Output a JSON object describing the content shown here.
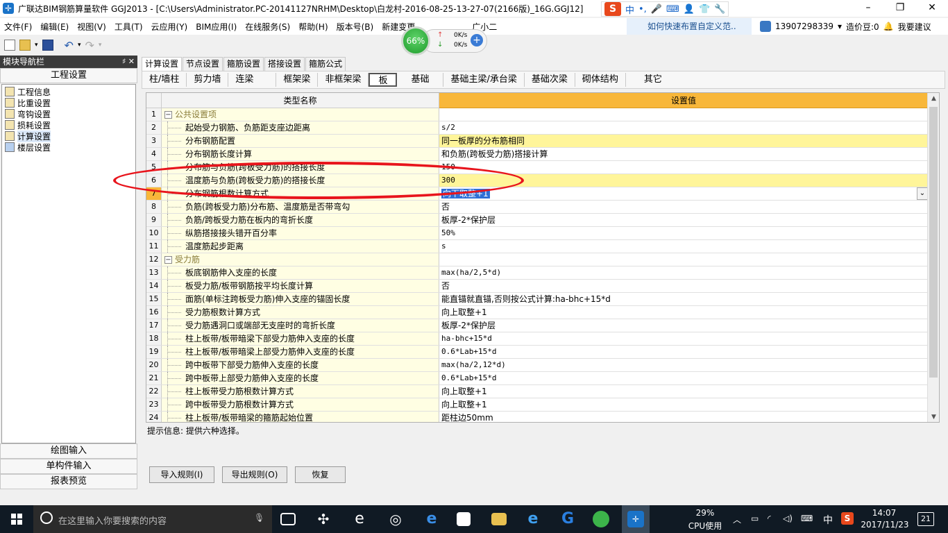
{
  "window": {
    "title": "广联达BIM钢筋算量软件 GGJ2013 - [C:\\Users\\Administrator.PC-20141127NRHM\\Desktop\\白龙村-2016-08-25-13-27-07(2166版)_16G.GGJ12]",
    "ime_label": "中",
    "controls": [
      "–",
      "❐",
      "✕"
    ]
  },
  "menu": {
    "items": [
      "文件(F)",
      "编辑(E)",
      "视图(V)",
      "工具(T)",
      "云应用(Y)",
      "BIM应用(I)",
      "在线服务(S)",
      "帮助(H)",
      "版本号(B)",
      "新建变更",
      "广小二"
    ],
    "help_link": "如何快速布置自定义范..",
    "phone": "13907298339",
    "coins": "造价豆:0",
    "feedback": "我要建议"
  },
  "speed": {
    "percent": "66%",
    "up": "0K/s",
    "down": "0K/s"
  },
  "nav": {
    "header": "模块导航栏",
    "header_ctrls": "♯ ✕",
    "section_top": "工程设置",
    "items": [
      "工程信息",
      "比重设置",
      "弯钩设置",
      "损耗设置",
      "计算设置",
      "楼层设置"
    ],
    "selected_index": 4,
    "bottom_sections": [
      "绘图输入",
      "单构件输入",
      "报表预览"
    ]
  },
  "tabs_top": [
    "计算设置",
    "节点设置",
    "箍筋设置",
    "搭接设置",
    "箍筋公式"
  ],
  "tabs_sub": [
    "柱/墙柱",
    "剪力墙",
    "连梁",
    "框架梁",
    "非框架梁",
    "板",
    "基础",
    "基础主梁/承台梁",
    "基础次梁",
    "砌体结构",
    "其它"
  ],
  "grid": {
    "col_name": "类型名称",
    "col_value": "设置值",
    "rows": [
      {
        "n": "1",
        "name": "公共设置项",
        "value": "",
        "group": true
      },
      {
        "n": "2",
        "name": "起始受力钢筋、负筋距支座边距离",
        "value": "s/2"
      },
      {
        "n": "3",
        "name": "分布钢筋配置",
        "value": "同一板厚的分布筋相同",
        "hl": true,
        "cjk": true
      },
      {
        "n": "4",
        "name": "分布钢筋长度计算",
        "value": "和负筋(跨板受力筋)搭接计算",
        "cjk": true
      },
      {
        "n": "5",
        "name": "分布筋与负筋(跨板受力筋)的搭接长度",
        "value": "150"
      },
      {
        "n": "6",
        "name": "温度筋与负筋(跨板受力筋)的搭接长度",
        "value": "300",
        "hl": true
      },
      {
        "n": "7",
        "name": "分布钢筋根数计算方式",
        "value": "向下取整+1",
        "editing": true,
        "cjk": true
      },
      {
        "n": "8",
        "name": "负筋(跨板受力筋)分布筋、温度筋是否带弯勾",
        "value": "否",
        "cjk": true
      },
      {
        "n": "9",
        "name": "负筋/跨板受力筋在板内的弯折长度",
        "value": "板厚-2*保护层",
        "cjk": true
      },
      {
        "n": "10",
        "name": "纵筋搭接接头错开百分率",
        "value": "50%"
      },
      {
        "n": "11",
        "name": "温度筋起步距离",
        "value": "s"
      },
      {
        "n": "12",
        "name": "受力筋",
        "value": "",
        "group": true
      },
      {
        "n": "13",
        "name": "板底钢筋伸入支座的长度",
        "value": "max(ha/2,5*d)"
      },
      {
        "n": "14",
        "name": "板受力筋/板带钢筋按平均长度计算",
        "value": "否",
        "cjk": true
      },
      {
        "n": "15",
        "name": "面筋(单标注跨板受力筋)伸入支座的锚固长度",
        "value": "能直锚就直锚,否则按公式计算:ha-bhc+15*d",
        "cjk": true
      },
      {
        "n": "16",
        "name": "受力筋根数计算方式",
        "value": "向上取整+1",
        "cjk": true
      },
      {
        "n": "17",
        "name": "受力筋遇洞口或端部无支座时的弯折长度",
        "value": "板厚-2*保护层",
        "cjk": true
      },
      {
        "n": "18",
        "name": "柱上板带/板带暗梁下部受力筋伸入支座的长度",
        "value": "ha-bhc+15*d"
      },
      {
        "n": "19",
        "name": "柱上板带/板带暗梁上部受力筋伸入支座的长度",
        "value": "0.6*Lab+15*d"
      },
      {
        "n": "20",
        "name": "跨中板带下部受力筋伸入支座的长度",
        "value": "max(ha/2,12*d)"
      },
      {
        "n": "21",
        "name": "跨中板带上部受力筋伸入支座的长度",
        "value": "0.6*Lab+15*d"
      },
      {
        "n": "22",
        "name": "柱上板带受力筋根数计算方式",
        "value": "向上取整+1",
        "cjk": true
      },
      {
        "n": "23",
        "name": "跨中板带受力筋根数计算方式",
        "value": "向上取整+1",
        "cjk": true
      },
      {
        "n": "24",
        "name": "柱上板带/板带暗梁的箍筋起始位置",
        "value": "距柱边50mm",
        "cjk": true
      }
    ]
  },
  "hint": "提示信息: 提供六种选择。",
  "buttons": {
    "import": "导入规则(I)",
    "export": "导出规则(O)",
    "restore": "恢复"
  },
  "taskbar": {
    "search_placeholder": "在这里输入你要搜索的内容",
    "cpu_percent": "29%",
    "cpu_label": "CPU使用",
    "ime": "中",
    "time": "14:07",
    "date": "2017/11/23",
    "notifications": "21"
  },
  "colors": {
    "header_value_bg": "#f8b73a",
    "highlight_row": "#fff59a",
    "annotation_ellipse": "#e8141c"
  }
}
